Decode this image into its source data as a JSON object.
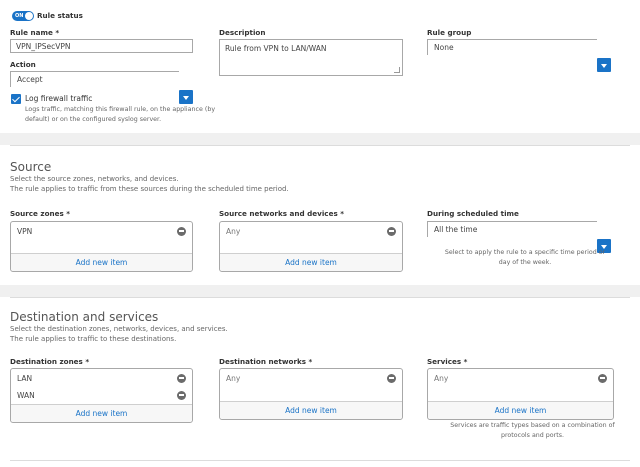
{
  "rule": {
    "status_label": "Rule status",
    "toggle_text": "ON",
    "name_label": "Rule name *",
    "name_value": "VPN_IPSecVPN",
    "description_label": "Description",
    "description_value": "Rule from VPN to LAN/WAN",
    "group_label": "Rule group",
    "group_value": "None",
    "action_label": "Action",
    "action_value": "Accept",
    "log_label": "Log firewall traffic",
    "log_help_1": "Logs traffic, matching this firewall rule, on the appliance (by",
    "log_help_2": "default) or on the configured syslog server."
  },
  "source": {
    "title": "Source",
    "desc_1": "Select the source zones, networks, and devices.",
    "desc_2": "The rule applies to traffic from these sources during the scheduled time period.",
    "zones_label": "Source zones *",
    "zones_items": [
      "VPN"
    ],
    "networks_label": "Source networks and devices *",
    "networks_placeholder": "Any",
    "schedule_label": "During scheduled time",
    "schedule_value": "All the time",
    "schedule_help_1": "Select to apply the rule to a specific time period or",
    "schedule_help_2": "day of the week.",
    "add_new": "Add new item"
  },
  "destination": {
    "title": "Destination and services",
    "desc_1": "Select the destination zones, networks, devices, and services.",
    "desc_2": "The rule applies to traffic to these destinations.",
    "zones_label": "Destination zones *",
    "zones_items": [
      "LAN",
      "WAN"
    ],
    "networks_label": "Destination networks *",
    "networks_placeholder": "Any",
    "services_label": "Services *",
    "services_placeholder": "Any",
    "services_help_1": "Services are traffic types based on a combination of",
    "services_help_2": "protocols and ports.",
    "add_new": "Add new item"
  },
  "colors": {
    "accent": "#1a73c7",
    "panel": "#ffffff",
    "background": "#f0f0f0"
  }
}
